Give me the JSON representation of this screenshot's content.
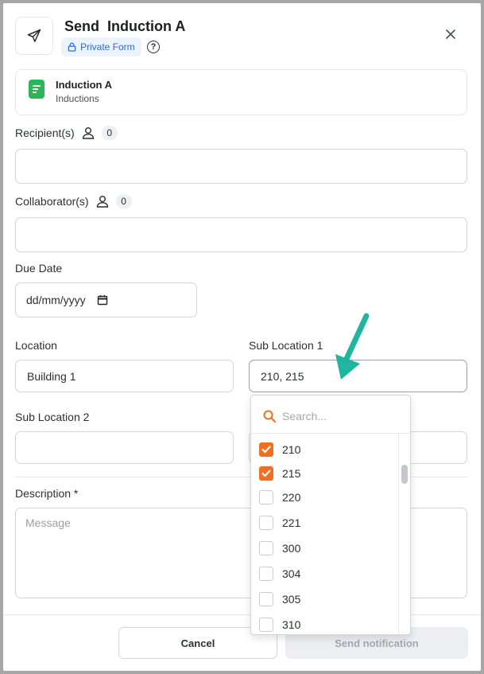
{
  "header": {
    "title": "Send  Induction A",
    "badge": "Private Form",
    "help": "?"
  },
  "form_card": {
    "name": "Induction A",
    "category": "Inductions"
  },
  "recipients": {
    "label": "Recipient(s)",
    "count": "0",
    "value": ""
  },
  "collaborators": {
    "label": "Collaborator(s)",
    "count": "0",
    "value": ""
  },
  "due_date": {
    "label": "Due Date",
    "placeholder": "dd/mm/yyyy"
  },
  "location": {
    "label": "Location",
    "value": "Building 1"
  },
  "sub_location_1": {
    "label": "Sub Location 1",
    "value": "210, 215"
  },
  "sub_location_2": {
    "label": "Sub Location 2",
    "value": ""
  },
  "description": {
    "label": "Description *",
    "placeholder": "Message"
  },
  "dropdown": {
    "search_placeholder": "Search...",
    "options": [
      {
        "label": "210",
        "checked": true
      },
      {
        "label": "215",
        "checked": true
      },
      {
        "label": "220",
        "checked": false
      },
      {
        "label": "221",
        "checked": false
      },
      {
        "label": "300",
        "checked": false
      },
      {
        "label": "304",
        "checked": false
      },
      {
        "label": "305",
        "checked": false
      },
      {
        "label": "310",
        "checked": false
      }
    ]
  },
  "footer": {
    "cancel_label": "Cancel",
    "send_label": "Send notification"
  },
  "colors": {
    "accent": "#f07020",
    "arrow": "#1fb5a0",
    "form_icon": "#2fb457",
    "badge_text": "#2a6bd9"
  }
}
